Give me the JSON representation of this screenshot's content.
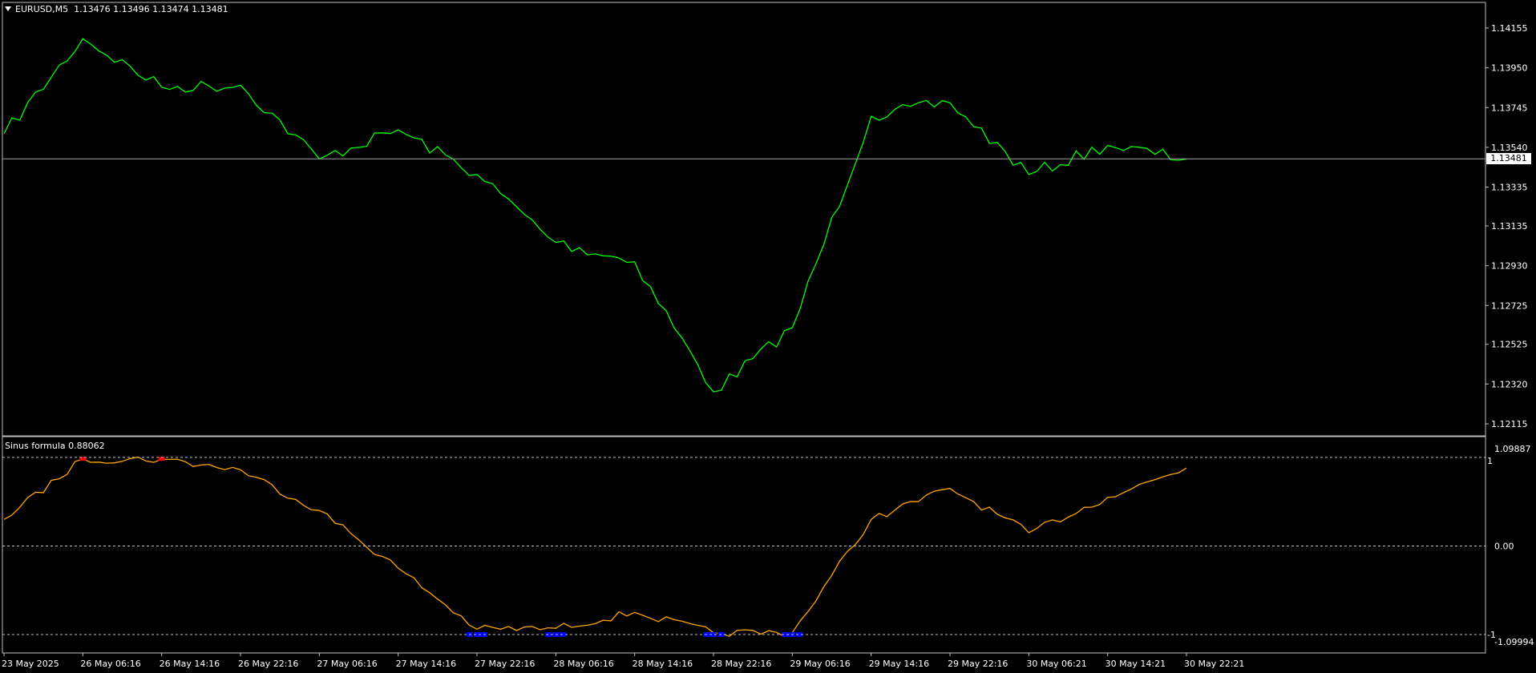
{
  "main_pane": {
    "symbol": "EURUSD,M5",
    "ohlc": "1.13476 1.13496 1.13474 1.13481",
    "price_axis": [
      "1.14155",
      "1.13950",
      "1.13745",
      "1.13540",
      "1.13335",
      "1.13135",
      "1.12930",
      "1.12725",
      "1.12525",
      "1.12320",
      "1.12115"
    ],
    "current_price": "1.13481"
  },
  "indicator_pane": {
    "name": "Sinus formula",
    "value": "0.88062",
    "axis_top": "1.09887",
    "axis_top_level": "1",
    "axis_mid": "0.00",
    "axis_bottom": "-1.09994",
    "axis_bottom_level": "-1"
  },
  "time_axis": [
    "23 May 2025",
    "26 May 06:16",
    "26 May 14:16",
    "26 May 22:16",
    "27 May 06:16",
    "27 May 14:16",
    "27 May 22:16",
    "28 May 06:16",
    "28 May 14:16",
    "28 May 22:16",
    "29 May 06:16",
    "29 May 14:16",
    "29 May 22:16",
    "30 May 06:21",
    "30 May 14:21",
    "30 May 22:21"
  ],
  "colors": {
    "background": "#000000",
    "frame": "#c0c0c0",
    "price_line": "#00ff00",
    "indicator_line": "#ffa500",
    "sell_marker": "#ff0000",
    "buy_marker": "#0000ff",
    "level_line": "#c0c0c0"
  },
  "chart_data": [
    {
      "type": "line",
      "series": [
        {
          "x": [
            "23 May 2025",
            "26 May 06:16",
            "26 May 14:16",
            "26 May 22:16",
            "27 May 06:16",
            "27 May 14:16",
            "27 May 22:16",
            "28 May 06:16",
            "28 May 14:16",
            "28 May 22:16",
            "29 May 06:16",
            "29 May 14:16",
            "29 May 22:16",
            "30 May 06:21",
            "30 May 14:21",
            "30 May 22:21"
          ],
          "values": [
            1.1361,
            1.141,
            1.1385,
            1.1386,
            1.1348,
            1.1363,
            1.134,
            1.1305,
            1.1295,
            1.1228,
            1.1261,
            1.137,
            1.1377,
            1.134,
            1.1355,
            1.1348
          ]
        }
      ],
      "ylim": [
        1.12115,
        1.14155
      ],
      "current": 1.13481
    },
    {
      "type": "line",
      "series": [
        {
          "x": [
            "23 May 2025",
            "26 May 06:16",
            "26 May 14:16",
            "26 May 22:16",
            "27 May 06:16",
            "27 May 14:16",
            "27 May 22:16",
            "28 May 06:16",
            "28 May 14:16",
            "28 May 22:16",
            "29 May 06:16",
            "29 May 14:16",
            "29 May 22:16",
            "30 May 06:21",
            "30 May 14:21",
            "30 May 22:21"
          ],
          "values": [
            0.3,
            0.98,
            0.98,
            0.86,
            0.4,
            -0.25,
            -0.94,
            -0.93,
            -0.75,
            -0.98,
            -0.98,
            0.3,
            0.65,
            0.15,
            0.55,
            0.88
          ]
        }
      ],
      "ylim": [
        -1.09994,
        1.09887
      ],
      "levels": [
        1,
        0,
        -1
      ]
    }
  ]
}
